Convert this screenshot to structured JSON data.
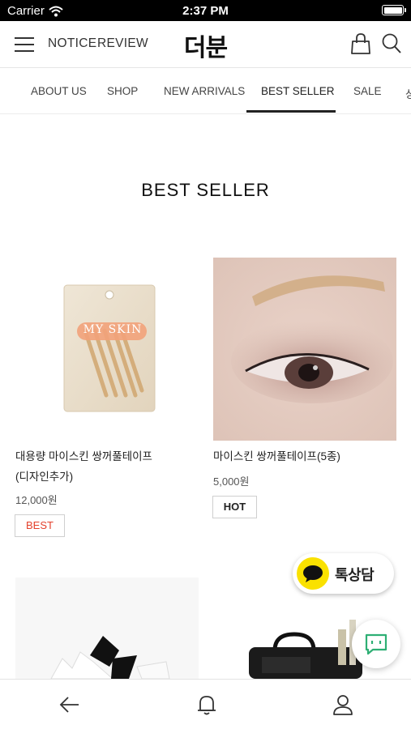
{
  "status_bar": {
    "carrier": "Carrier",
    "time": "2:37 PM"
  },
  "header": {
    "logo": "더분",
    "links": [
      "NOTICE",
      "REVIEW"
    ],
    "icons": [
      "menu-icon",
      "shopping-bag-icon",
      "search-icon"
    ]
  },
  "category_nav": {
    "items": [
      "ABOUT US",
      "SHOP",
      "NEW ARRIVALS",
      "BEST SELLER",
      "SALE",
      "상"
    ],
    "active": "BEST SELLER"
  },
  "section": {
    "title": "BEST SELLER"
  },
  "products": [
    {
      "name_line1": "대용량 마이스킨 쌍꺼풀테이프",
      "name_line2": "(디자인추가)",
      "price": "12,000원",
      "badge": "BEST",
      "package_text": "MY SKIN"
    },
    {
      "name_line1": "마이스킨 쌍꺼풀테이프(5종)",
      "price": "5,000원",
      "badge": "HOT"
    }
  ],
  "floating": {
    "kakao_label": "톡상담"
  },
  "bottom_bar": {
    "icons": [
      "back-arrow-icon",
      "bell-icon",
      "user-icon"
    ]
  },
  "colors": {
    "best_badge": "#e4412c",
    "kakao_yellow": "#fae100",
    "chat_green": "#2eaf74",
    "active_underline": "#222222"
  }
}
